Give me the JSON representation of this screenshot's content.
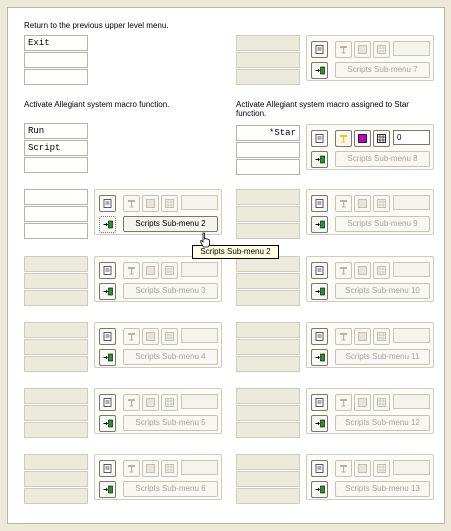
{
  "sections": {
    "return_desc": "Return to the previous upper level menu.",
    "activate_desc": "Activate Allegiant system macro function.",
    "star_desc": "Activate Allegiant system macro assigned to Star function."
  },
  "fields": {
    "exit": "Exit",
    "run": "Run",
    "script": "Script",
    "star": "*Star"
  },
  "star_group": {
    "number_value": "0"
  },
  "submenus": [
    "Scripts Sub-menu 2",
    "Scripts Sub-menu 3",
    "Scripts Sub-menu 4",
    "Scripts Sub-menu 5",
    "Scripts Sub-menu 6",
    "Scripts Sub-menu 7",
    "Scripts Sub-menu 8",
    "Scripts Sub-menu 9",
    "Scripts Sub-menu 10",
    "Scripts Sub-menu 11",
    "Scripts Sub-menu 12",
    "Scripts Sub-menu 13"
  ],
  "tooltip": "Scripts Sub-menu 2",
  "icons": {
    "page": "page-icon",
    "flag": "flag-icon",
    "box": "box-icon",
    "grid": "grid-icon",
    "arrow": "arrow-into-box-icon"
  },
  "colors": {
    "accent_green": "#1e9a1e",
    "accent_magenta": "#c000c0",
    "accent_yellow": "#f2d000",
    "tooltip_bg": "#ffffe1",
    "disabled_text": "#a6a398"
  }
}
